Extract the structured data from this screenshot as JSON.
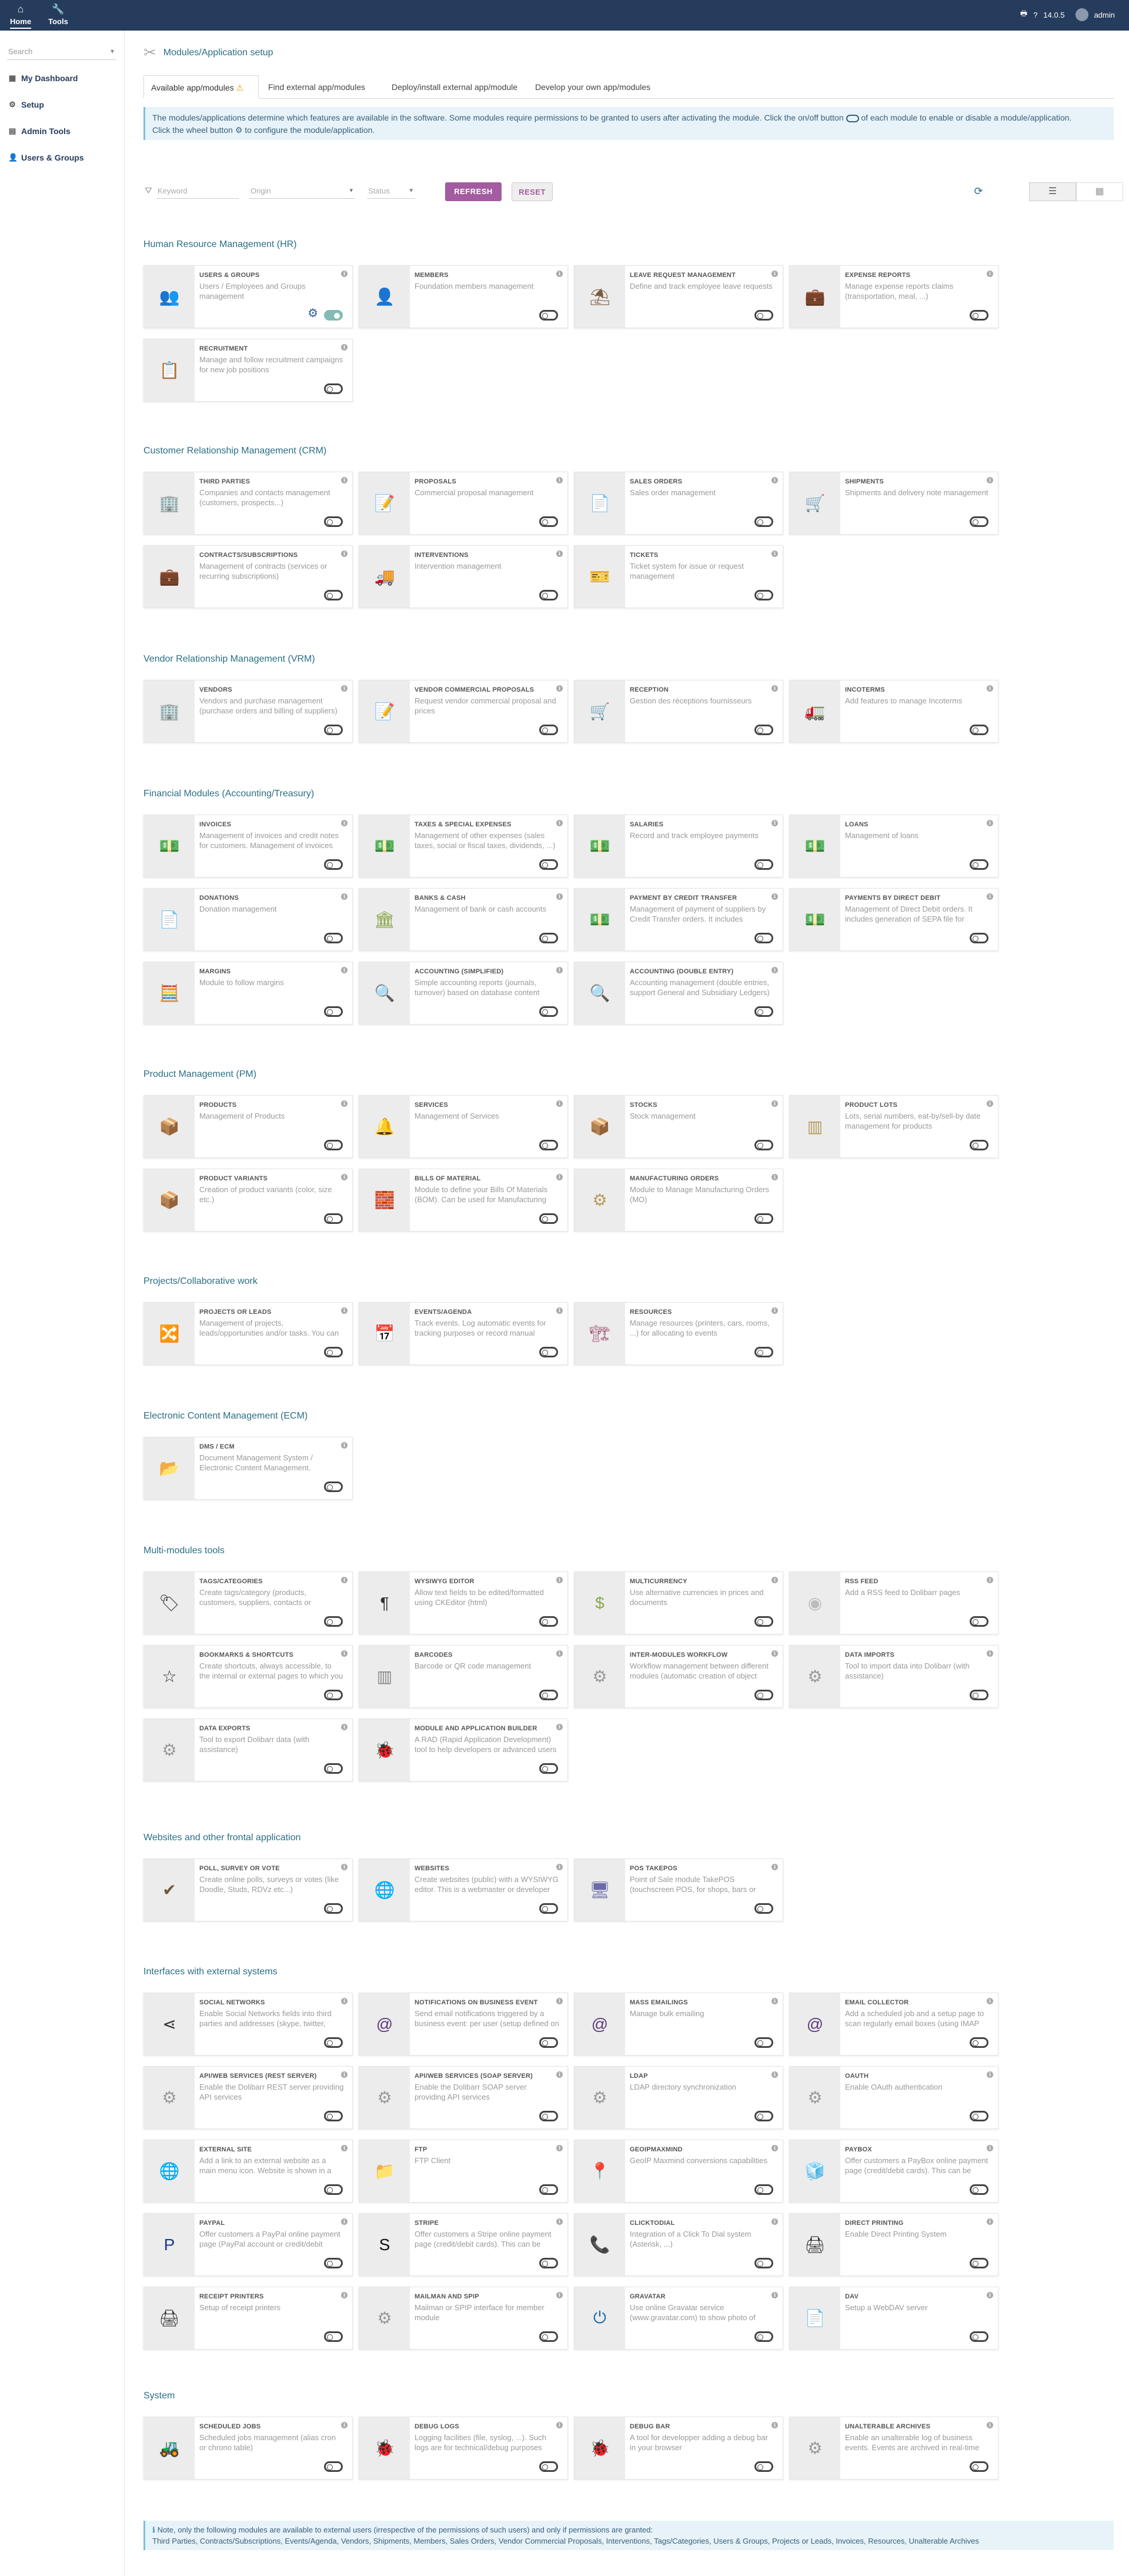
{
  "topbar": {
    "nav": [
      {
        "label": "Home",
        "icon": "home-icon"
      },
      {
        "label": "Tools",
        "icon": "wrench-icon"
      }
    ],
    "version": "14.0.5",
    "user": "admin"
  },
  "sidebar": {
    "search_placeholder": "Search",
    "items": [
      {
        "label": "My Dashboard",
        "icon": "dashboard-icon"
      },
      {
        "label": "Setup",
        "icon": "setup-icon"
      },
      {
        "label": "Admin Tools",
        "icon": "admin-tools-icon"
      },
      {
        "label": "Users & Groups",
        "icon": "users-icon"
      }
    ]
  },
  "page": {
    "title": "Modules/Application setup",
    "tabs": [
      {
        "label": "Available app/modules"
      },
      {
        "label": "Find external app/modules"
      },
      {
        "label": "Deploy/install external app/module"
      },
      {
        "label": "Develop your own app/modules"
      }
    ],
    "info_line1a": "The modules/applications determine which features are available in the software. Some modules require permissions to be granted to users after activating the module. Click the on/off button",
    "info_line1b": "of each module to enable or disable a module/application.",
    "info_line2": "Click the wheel button ⚙ to configure the module/application."
  },
  "filters": {
    "keyword_placeholder": "Keyword",
    "origin_placeholder": "Origin",
    "status_placeholder": "Status",
    "refresh_label": "REFRESH",
    "reset_label": "RESET"
  },
  "sections": [
    {
      "title": "Human Resource Management (HR)",
      "modules": [
        {
          "name": "Users & Groups",
          "desc": "Users / Employees and Groups management",
          "icon": "👥",
          "color": "#7a5a3a",
          "enabled": true,
          "has_config": true
        },
        {
          "name": "Members",
          "desc": "Foundation members management",
          "icon": "👤",
          "color": "#7a5a3a",
          "enabled": false
        },
        {
          "name": "Leave request management",
          "desc": "Define and track employee leave requests",
          "icon": "⛱",
          "color": "#7a5a3a",
          "enabled": false
        },
        {
          "name": "Expense reports",
          "desc": "Manage expense reports claims (transportation, meal, ...)",
          "icon": "💼",
          "color": "#7a5a3a",
          "enabled": false
        },
        {
          "name": "Recruitment",
          "desc": "Manage and follow recruitment campaigns for new job positions",
          "icon": "📋",
          "color": "#7a5a3a",
          "enabled": false
        }
      ]
    },
    {
      "title": "Customer Relationship Management (CRM)",
      "modules": [
        {
          "name": "Third Parties",
          "desc": "Companies and contacts management (customers, prospects...)",
          "icon": "🏢",
          "color": "#6c6aa8",
          "enabled": false
        },
        {
          "name": "Proposals",
          "desc": "Commercial proposal management",
          "icon": "📝",
          "color": "#56a356",
          "enabled": false
        },
        {
          "name": "Sales Orders",
          "desc": "Sales order management",
          "icon": "📄",
          "color": "#56a356",
          "enabled": false
        },
        {
          "name": "Shipments",
          "desc": "Shipments and delivery note management",
          "icon": "🛒",
          "color": "#56a356",
          "enabled": false
        },
        {
          "name": "Contracts/Subscriptions",
          "desc": "Management of contracts (services or recurring subscriptions)",
          "icon": "💼",
          "color": "#46b5a6",
          "enabled": false
        },
        {
          "name": "Interventions",
          "desc": "Intervention management",
          "icon": "🚚",
          "color": "#46b5a6",
          "enabled": false
        },
        {
          "name": "Tickets",
          "desc": "Ticket system for issue or request management",
          "icon": "🎫",
          "color": "#46b5a6",
          "enabled": false
        }
      ]
    },
    {
      "title": "Vendor Relationship Management (VRM)",
      "modules": [
        {
          "name": "Vendors",
          "desc": "Vendors and purchase management (purchase orders and billing of suppliers)",
          "icon": "🏢",
          "color": "#6c6aa8",
          "enabled": false
        },
        {
          "name": "Vendor commercial proposals",
          "desc": "Request vendor commercial proposal and prices",
          "icon": "📝",
          "color": "#6c6aa8",
          "enabled": false
        },
        {
          "name": "Reception",
          "desc": "Gestion des réceptions fournisseurs",
          "icon": "🛒",
          "color": "#6c6aa8",
          "enabled": false
        },
        {
          "name": "Incoterms",
          "desc": "Add features to manage Incoterms",
          "icon": "🚛",
          "color": "#6c6aa8",
          "enabled": false
        }
      ]
    },
    {
      "title": "Financial Modules (Accounting/Treasury)",
      "modules": [
        {
          "name": "Invoices",
          "desc": "Management of invoices and credit notes for customers. Management of invoices and credit notes for suppliers",
          "icon": "💵",
          "color": "#8aa84a",
          "enabled": false
        },
        {
          "name": "Taxes & Special expenses",
          "desc": "Management of other expenses (sales taxes, social or fiscal taxes, dividends, ...)",
          "icon": "💵",
          "color": "#8aa84a",
          "enabled": false
        },
        {
          "name": "Salaries",
          "desc": "Record and track employee payments",
          "icon": "💵",
          "color": "#8aa84a",
          "enabled": false
        },
        {
          "name": "Loans",
          "desc": "Management of loans",
          "icon": "💵",
          "color": "#8aa84a",
          "enabled": false
        },
        {
          "name": "Donations",
          "desc": "Donation management",
          "icon": "📄",
          "color": "#8aa84a",
          "enabled": false
        },
        {
          "name": "Banks & Cash",
          "desc": "Management of bank or cash accounts",
          "icon": "🏛",
          "color": "#8aa84a",
          "enabled": false
        },
        {
          "name": "Payment by credit transfer",
          "desc": "Management of payment of suppliers by Credit Transfer orders. It includes generation of SEPA file",
          "icon": "💵",
          "color": "#8aa84a",
          "enabled": false
        },
        {
          "name": "Payments by Direct Debit",
          "desc": "Management of Direct Debit orders. It includes generation of SEPA file for European countries",
          "icon": "💵",
          "color": "#8aa84a",
          "enabled": false
        },
        {
          "name": "Margins",
          "desc": "Module to follow margins",
          "icon": "🧮",
          "color": "#8aa84a",
          "enabled": false
        },
        {
          "name": "Accounting (simplified)",
          "desc": "Simple accounting reports (journals, turnover) based on database content",
          "icon": "🔍",
          "color": "#8aa84a",
          "enabled": false
        },
        {
          "name": "Accounting (double entry)",
          "desc": "Accounting management (double entries, support General and Subsidiary Ledgers)",
          "icon": "🔍",
          "color": "#8aa84a",
          "enabled": false
        }
      ]
    },
    {
      "title": "Product Management (PM)",
      "modules": [
        {
          "name": "Products",
          "desc": "Management of Products",
          "icon": "📦",
          "color": "#b59a5a",
          "enabled": false
        },
        {
          "name": "Services",
          "desc": "Management of Services",
          "icon": "🔔",
          "color": "#b59a5a",
          "enabled": false
        },
        {
          "name": "Stocks",
          "desc": "Stock management",
          "icon": "📦",
          "color": "#b59a5a",
          "enabled": false
        },
        {
          "name": "Product Lots",
          "desc": "Lots, serial numbers, eat-by/sell-by date management for products",
          "icon": "▥",
          "color": "#b59a5a",
          "enabled": false
        },
        {
          "name": "Product Variants",
          "desc": "Creation of product variants (color, size etc.)",
          "icon": "📦",
          "color": "#b59a5a",
          "enabled": false
        },
        {
          "name": "Bills of Material",
          "desc": "Module to define your Bills Of Materials (BOM). Can be used for Manufacturing Resource Planning",
          "icon": "🧱",
          "color": "#b59a5a",
          "enabled": false
        },
        {
          "name": "Manufacturing Orders",
          "desc": "Module to Manage Manufacturing Orders (MO)",
          "icon": "⚙",
          "color": "#b59a5a",
          "enabled": false
        }
      ]
    },
    {
      "title": "Projects/Collaborative work",
      "modules": [
        {
          "name": "Projects or Leads",
          "desc": "Management of projects, leads/opportunities and/or tasks. You can also assign any element",
          "icon": "🔀",
          "color": "#7a4a7a",
          "enabled": false
        },
        {
          "name": "Events/Agenda",
          "desc": "Track events. Log automatic events for tracking purposes or record manual events",
          "icon": "📅",
          "color": "#a25a7a",
          "enabled": false
        },
        {
          "name": "Resources",
          "desc": "Manage resources (printers, cars, rooms, ...) for allocating to events",
          "icon": "🏗",
          "color": "#a25a7a",
          "enabled": false
        }
      ]
    },
    {
      "title": "Electronic Content Management (ECM)",
      "modules": [
        {
          "name": "DMS / ECM",
          "desc": "Document Management System / Electronic Content Management. Automatic organization",
          "icon": "📂",
          "color": "#333",
          "enabled": false
        }
      ]
    },
    {
      "title": "Multi-modules tools",
      "modules": [
        {
          "name": "Tags/Categories",
          "desc": "Create tags/category (products, customers, suppliers, contacts or members)",
          "icon": "🏷",
          "color": "#333",
          "enabled": false
        },
        {
          "name": "WYSIWYG Editor",
          "desc": "Allow text fields to be edited/formatted using CKEditor (html)",
          "icon": "¶",
          "color": "#333",
          "enabled": false
        },
        {
          "name": "Multicurrency",
          "desc": "Use alternative currencies in prices and documents",
          "icon": "$",
          "color": "#8aa84a",
          "enabled": false
        },
        {
          "name": "RSS Feed",
          "desc": "Add a RSS feed to Dolibarr pages",
          "icon": "◉",
          "color": "#bbb",
          "enabled": false
        },
        {
          "name": "Bookmarks & Shortcuts",
          "desc": "Create shortcuts, always accessible, to the internal or external pages to which you frequently access",
          "icon": "☆",
          "color": "#333",
          "enabled": false
        },
        {
          "name": "Barcodes",
          "desc": "Barcode or QR code management",
          "icon": "▥",
          "color": "#888",
          "enabled": false
        },
        {
          "name": "Inter-modules workflow",
          "desc": "Workflow management between different modules (automatic creation of object and/or automatic status change)",
          "icon": "⚙",
          "color": "#999",
          "enabled": false
        },
        {
          "name": "Data imports",
          "desc": "Tool to import data into Dolibarr (with assistance)",
          "icon": "⚙",
          "color": "#999",
          "enabled": false
        },
        {
          "name": "Data exports",
          "desc": "Tool to export Dolibarr data (with assistance)",
          "icon": "⚙",
          "color": "#999",
          "enabled": false
        },
        {
          "name": "Module and Application Builder",
          "desc": "A RAD (Rapid Application Development) tool to help developers or advanced users",
          "icon": "🐞",
          "color": "#333",
          "enabled": false
        }
      ]
    },
    {
      "title": "Websites and other frontal application",
      "modules": [
        {
          "name": "Poll, Survey or Vote",
          "desc": "Create online polls, surveys or votes (like Doodle, Studs, RDVz etc...)",
          "icon": "✔",
          "color": "#6c5a3a",
          "enabled": false
        },
        {
          "name": "Websites",
          "desc": "Create websites (public) with a WYSIWYG editor. This is a webmaster or developer oriented CMS",
          "icon": "🌐",
          "color": "#5a3a7a",
          "enabled": false
        },
        {
          "name": "POS TakePOS",
          "desc": "Point of Sale module TakePOS (touchscreen POS, for shops, bars or restaurants)",
          "icon": "🖥",
          "color": "#6c6aa8",
          "enabled": false
        }
      ]
    },
    {
      "title": "Interfaces with external systems",
      "modules": [
        {
          "name": "Social Networks",
          "desc": "Enable Social Networks fields into third parties and addresses (skype, twitter, facebook, ...)",
          "icon": "⋖",
          "color": "#333",
          "enabled": false
        },
        {
          "name": "Notifications on business event",
          "desc": "Send email notifications triggered by a business event: per user (setup defined on each user)",
          "icon": "@",
          "color": "#5a3a7a",
          "enabled": false
        },
        {
          "name": "Mass Emailings",
          "desc": "Manage bulk emailing",
          "icon": "@",
          "color": "#5a3a7a",
          "enabled": false
        },
        {
          "name": "Email Collector",
          "desc": "Add a scheduled job and a setup page to scan regularly email boxes (using IMAP protocol)",
          "icon": "@",
          "color": "#5a3a7a",
          "enabled": false
        },
        {
          "name": "API/Web services (REST server)",
          "desc": "Enable the Dolibarr REST server providing API services",
          "icon": "⚙",
          "color": "#999",
          "enabled": false
        },
        {
          "name": "API/Web services (SOAP server)",
          "desc": "Enable the Dolibarr SOAP server providing API services",
          "icon": "⚙",
          "color": "#999",
          "enabled": false
        },
        {
          "name": "LDAP",
          "desc": "LDAP directory synchronization",
          "icon": "⚙",
          "color": "#999",
          "enabled": false
        },
        {
          "name": "OAuth",
          "desc": "Enable OAuth authentication",
          "icon": "⚙",
          "color": "#999",
          "enabled": false
        },
        {
          "name": "External Site",
          "desc": "Add a link to an external website as a main menu icon. Website is shown in a frame under the top menu",
          "icon": "🌐",
          "color": "#5a3a7a",
          "enabled": false
        },
        {
          "name": "FTP",
          "desc": "FTP Client",
          "icon": "📁",
          "color": "#cc3",
          "enabled": false
        },
        {
          "name": "GeoIPMaxmind",
          "desc": "GeoIP Maxmind conversions capabilities",
          "icon": "📍",
          "color": "#222",
          "enabled": false
        },
        {
          "name": "PayBox",
          "desc": "Offer customers a PayBox online payment page (credit/debit cards). This can be used to allow your customers",
          "icon": "🧊",
          "color": "#3a8ad0",
          "enabled": false
        },
        {
          "name": "PayPal",
          "desc": "Offer customers a PayPal online payment page (PayPal account or credit/debit cards)",
          "icon": "P",
          "color": "#1a3a8a",
          "enabled": false
        },
        {
          "name": "Stripe",
          "desc": "Offer customers a Stripe online payment page (credit/debit cards). This can be used",
          "icon": "S",
          "color": "#111",
          "enabled": false
        },
        {
          "name": "ClickToDial",
          "desc": "Integration of a Click To Dial system (Asterisk, ...)",
          "icon": "📞",
          "color": "#3a7a3a",
          "enabled": false
        },
        {
          "name": "Direct Printing",
          "desc": "Enable Direct Printing System",
          "icon": "🖨",
          "color": "#333",
          "enabled": false
        },
        {
          "name": "Receipt printers",
          "desc": "Setup of receipt printers",
          "icon": "🖨",
          "color": "#333",
          "enabled": false
        },
        {
          "name": "Mailman and SPIP",
          "desc": "Mailman or SPIP interface for member module",
          "icon": "⚙",
          "color": "#999",
          "enabled": false
        },
        {
          "name": "Gravatar",
          "desc": "Use online Gravatar service (www.gravatar.com) to show photo of users/members",
          "icon": "⏻",
          "color": "#1a6aa8",
          "enabled": false
        },
        {
          "name": "DAV",
          "desc": "Setup a WebDAV server",
          "icon": "📄",
          "color": "#333",
          "enabled": false
        }
      ]
    },
    {
      "title": "System",
      "modules": [
        {
          "name": "Scheduled jobs",
          "desc": "Scheduled jobs management (alias cron or chrono table)",
          "icon": "🚜",
          "color": "#333",
          "enabled": false
        },
        {
          "name": "Debug Logs",
          "desc": "Logging facilities (file, syslog, ...). Such logs are for technical/debug purposes",
          "icon": "🐞",
          "color": "#333",
          "enabled": false
        },
        {
          "name": "Debug Bar",
          "desc": "A tool for developper adding a debug bar in your browser",
          "icon": "🐞",
          "color": "#333",
          "enabled": false
        },
        {
          "name": "Unalterable Archives",
          "desc": "Enable an unalterable log of business events. Events are archived in real-time",
          "icon": "⚙",
          "color": "#999",
          "enabled": false
        }
      ]
    }
  ],
  "footnote": {
    "line1": "Note, only the following modules are available to external users (irrespective of the permissions of such users) and only if permissions are granted:",
    "line2": "Third Parties, Contracts/Subscriptions, Events/Agenda, Vendors, Shipments, Members, Sales Orders, Vendor Commercial Proposals, Interventions, Tags/Categories, Users & Groups, Projects or Leads, Invoices, Resources, Unalterable Archives"
  }
}
